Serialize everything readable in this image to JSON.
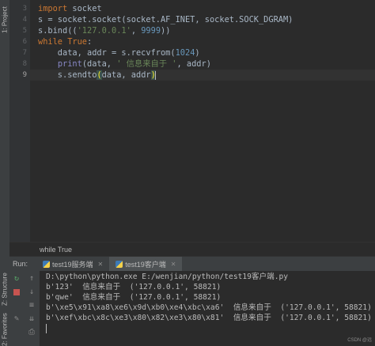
{
  "side_tools": {
    "project": "1: Project",
    "structure": "Z: Structure",
    "favorites": "2: Favorites"
  },
  "editor": {
    "line_numbers": [
      "3",
      "4",
      "5",
      "6",
      "7",
      "8",
      "9"
    ],
    "current_line": "9"
  },
  "breadcrumb": "while True",
  "run_panel": {
    "label": "Run:",
    "tabs": [
      {
        "label": "test19服务端",
        "active": false
      },
      {
        "label": "test19客户端",
        "active": true
      }
    ],
    "output": [
      "D:\\python\\python.exe E:/wenjian/python/test19客户端.py",
      "b'123'  信息来自于  ('127.0.0.1', 58821)",
      "b'qwe'  信息来自于  ('127.0.0.1', 58821)",
      "b'\\xe5\\x91\\xa8\\xe6\\x9d\\xb0\\xe4\\xbc\\xa6'  信息来自于  ('127.0.0.1', 58821)",
      "b'\\xef\\xbc\\x8c\\xe3\\x80\\x82\\xe3\\x80\\x81'  信息来自于  ('127.0.0.1', 58821)"
    ]
  },
  "watermark": "CSDN @远",
  "colors": {
    "keyword": "#cc7832",
    "string": "#6a8759",
    "number": "#6897bb",
    "builtin": "#8888c6"
  }
}
